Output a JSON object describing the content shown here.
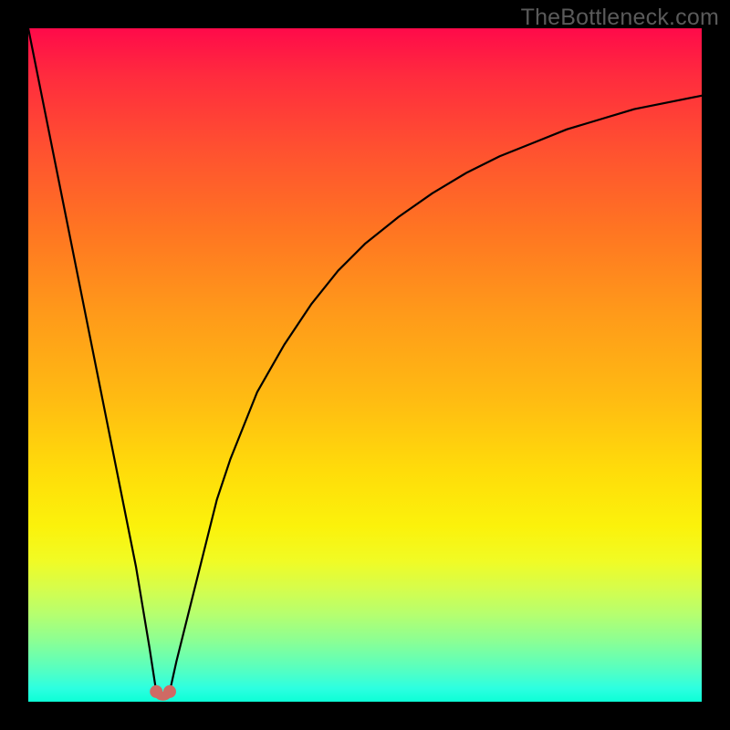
{
  "watermark": "TheBottleneck.com",
  "colors": {
    "frame": "#000000",
    "curve": "#000000",
    "marker": "#cf6a64"
  },
  "chart_data": {
    "type": "line",
    "title": "",
    "xlabel": "",
    "ylabel": "",
    "xlim": [
      0,
      100
    ],
    "ylim": [
      0,
      100
    ],
    "grid": false,
    "legend": false,
    "x": [
      0,
      2,
      4,
      6,
      8,
      10,
      12,
      14,
      16,
      18,
      19,
      20,
      21,
      22,
      24,
      26,
      28,
      30,
      34,
      38,
      42,
      46,
      50,
      55,
      60,
      65,
      70,
      75,
      80,
      85,
      90,
      95,
      100
    ],
    "y": [
      100,
      90,
      80,
      70,
      60,
      50,
      40,
      30,
      20,
      8,
      1.5,
      0.8,
      1.5,
      6,
      14,
      22,
      30,
      36,
      46,
      53,
      59,
      64,
      68,
      72,
      75.5,
      78.5,
      81,
      83,
      85,
      86.5,
      88,
      89,
      90
    ],
    "markers": {
      "x": [
        19,
        21
      ],
      "y": [
        1.5,
        1.5
      ]
    },
    "note": "Values are approximate readings from the rendered curve in percent of plot area; y=100 is top (worst), y=0 is bottom (best)."
  }
}
